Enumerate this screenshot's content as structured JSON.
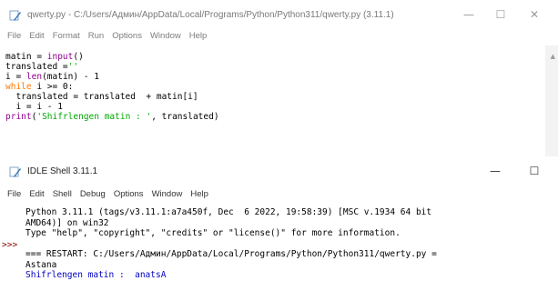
{
  "editor": {
    "title": "qwerty.py - C:/Users/Админ/AppData/Local/Programs/Python/Python311/qwerty.py (3.11.1)",
    "menu": [
      "File",
      "Edit",
      "Format",
      "Run",
      "Options",
      "Window",
      "Help"
    ],
    "controls": {
      "minimize": "—",
      "maximize": "☐",
      "close": "✕"
    },
    "code": {
      "l1_a": "matin = ",
      "l1_fn": "input",
      "l1_b": "()",
      "l2_a": "translated =",
      "l2_str": "''",
      "l3_a": "i = ",
      "l3_fn": "len",
      "l3_b": "(matin) - 1",
      "l4_kw": "while",
      "l4_b": " i >= 0:",
      "l5": "  translated = translated  + matin[i]",
      "l6": "  i = i - 1",
      "l7_fn": "print",
      "l7_a": "(",
      "l7_str": "'Shifrlengen matin : '",
      "l7_b": ", translated)"
    }
  },
  "shell": {
    "title": "IDLE Shell 3.11.1",
    "menu": [
      "File",
      "Edit",
      "Shell",
      "Debug",
      "Options",
      "Window",
      "Help"
    ],
    "controls": {
      "minimize": "—",
      "maximize": "☐"
    },
    "prompt": ">>>",
    "lines": {
      "banner1": "Python 3.11.1 (tags/v3.11.1:a7a450f, Dec  6 2022, 19:58:39) [MSC v.1934 64 bit",
      "banner2": "AMD64)] on win32",
      "banner3": "Type \"help\", \"copyright\", \"credits\" or \"license()\" for more information.",
      "restart": "=== RESTART: C:/Users/Админ/AppData/Local/Programs/Python/Python311/qwerty.py =",
      "input": "Astana",
      "output": "Shifrlengen matin :  anatsA"
    }
  },
  "colors": {
    "keyword": "#ff7700",
    "builtin": "#900090",
    "string": "#00aa00",
    "output": "#0000c0",
    "prompt": "#8b0000"
  }
}
